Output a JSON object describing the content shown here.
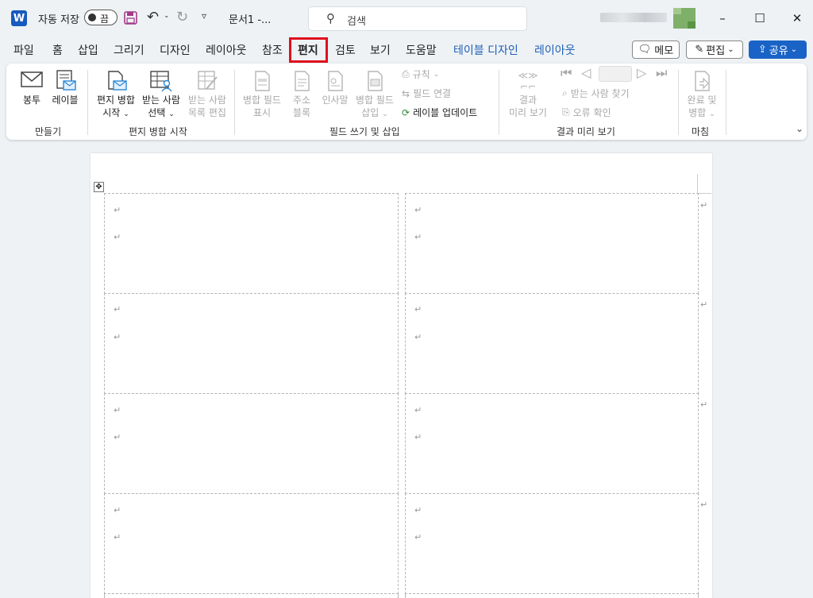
{
  "titlebar": {
    "app_icon": "W",
    "autosave_label": "자동 저장",
    "autosave_state": "끔",
    "doc_title": "문서1 -...",
    "search_placeholder": "검색",
    "minimize": "–",
    "maximize": "☐",
    "close": "✕"
  },
  "tabs": [
    {
      "label": "파일"
    },
    {
      "label": "홈"
    },
    {
      "label": "삽입"
    },
    {
      "label": "그리기"
    },
    {
      "label": "디자인"
    },
    {
      "label": "레이아웃"
    },
    {
      "label": "참조"
    },
    {
      "label": "편지"
    },
    {
      "label": "검토"
    },
    {
      "label": "보기"
    },
    {
      "label": "도움말"
    },
    {
      "label": "테이블 디자인"
    },
    {
      "label": "레이아웃"
    }
  ],
  "active_tab": "편지",
  "header_buttons": {
    "memo": "메모",
    "edit": "편집",
    "share": "공유"
  },
  "ribbon": {
    "groups": {
      "create": "만들기",
      "start_merge": "편지 병합 시작",
      "write_insert": "필드 쓰기 및 삽입",
      "preview": "결과 미리 보기",
      "finish": "마침"
    },
    "buttons": {
      "envelope": "봉투",
      "labels": "레이블",
      "start_merge_1": "편지 병합",
      "start_merge_2": "시작",
      "select_recipients_1": "받는 사람",
      "select_recipients_2": "선택",
      "edit_list_1": "받는 사람",
      "edit_list_2": "목록 편집",
      "highlight_1": "병합 필드",
      "highlight_2": "표시",
      "address_1": "주소",
      "address_2": "블록",
      "greeting": "인사말",
      "insert_field_1": "병합 필드",
      "insert_field_2": "삽입",
      "rules": "규칙",
      "match_fields": "필드 연결",
      "update_labels": "레이블 업데이트",
      "preview_1": "결과",
      "preview_2": "미리 보기",
      "find_recipient": "받는 사람 찾기",
      "check_errors": "오류 확인",
      "finish_1": "완료 및",
      "finish_2": "병합"
    }
  },
  "document": {
    "paragraph_mark": "↵",
    "rows": 4,
    "cols": 2
  },
  "colors": {
    "accent": "#1f5fb8",
    "highlight_box": "#e0101c",
    "share_bg": "#1a63c6"
  }
}
